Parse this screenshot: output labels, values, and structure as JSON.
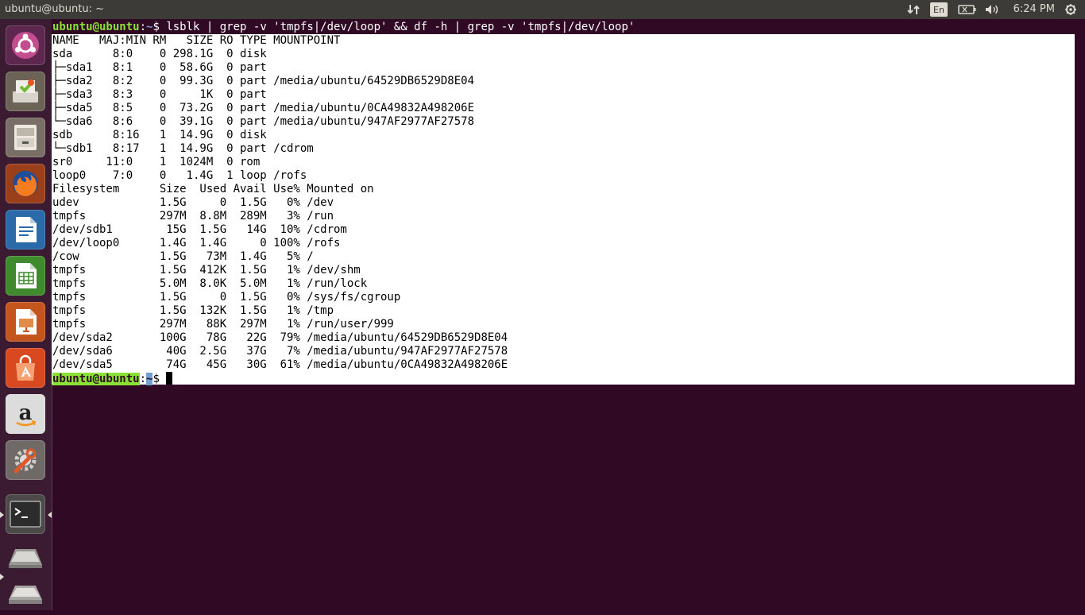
{
  "top_panel": {
    "window_title": "ubuntu@ubuntu: ~",
    "language": "En",
    "clock": "6:24 PM"
  },
  "launcher": {
    "items": [
      {
        "name": "dash-home",
        "icon": "ubuntu-logo-icon"
      },
      {
        "name": "install-ubuntu",
        "icon": "installer-icon"
      },
      {
        "name": "files",
        "icon": "file-cabinet-icon"
      },
      {
        "name": "firefox",
        "icon": "firefox-icon"
      },
      {
        "name": "libreoffice-writer",
        "icon": "writer-icon"
      },
      {
        "name": "libreoffice-calc",
        "icon": "calc-icon"
      },
      {
        "name": "libreoffice-impress",
        "icon": "impress-icon"
      },
      {
        "name": "ubuntu-software",
        "icon": "shopping-bag-icon"
      },
      {
        "name": "amazon",
        "icon": "amazon-icon"
      },
      {
        "name": "system-settings",
        "icon": "wrench-gear-icon"
      },
      {
        "name": "terminal",
        "icon": "terminal-icon"
      },
      {
        "name": "workspace-switcher",
        "icon": "workspace-icon"
      },
      {
        "name": "trash",
        "icon": "trash-icon"
      }
    ]
  },
  "terminal": {
    "prompt_user": "ubuntu@ubuntu",
    "prompt_sep": ":",
    "prompt_path": "~",
    "prompt_end": "$ ",
    "command": "lsblk | grep -v 'tmpfs|/dev/loop' && df -h | grep -v 'tmpfs|/dev/loop'",
    "lines": [
      "NAME   MAJ:MIN RM   SIZE RO TYPE MOUNTPOINT",
      "sda      8:0    0 298.1G  0 disk",
      "├─sda1   8:1    0  58.6G  0 part",
      "├─sda2   8:2    0  99.3G  0 part /media/ubuntu/64529DB6529D8E04",
      "├─sda3   8:3    0     1K  0 part",
      "├─sda5   8:5    0  73.2G  0 part /media/ubuntu/0CA49832A498206E",
      "└─sda6   8:6    0  39.1G  0 part /media/ubuntu/947AF2977AF27578",
      "sdb      8:16   1  14.9G  0 disk",
      "└─sdb1   8:17   1  14.9G  0 part /cdrom",
      "sr0     11:0    1  1024M  0 rom",
      "loop0    7:0    0   1.4G  1 loop /rofs",
      "Filesystem      Size  Used Avail Use% Mounted on",
      "udev            1.5G     0  1.5G   0% /dev",
      "tmpfs           297M  8.8M  289M   3% /run",
      "/dev/sdb1        15G  1.5G   14G  10% /cdrom",
      "/dev/loop0      1.4G  1.4G     0 100% /rofs",
      "/cow            1.5G   73M  1.4G   5% /",
      "tmpfs           1.5G  412K  1.5G   1% /dev/shm",
      "tmpfs           5.0M  8.0K  5.0M   1% /run/lock",
      "tmpfs           1.5G     0  1.5G   0% /sys/fs/cgroup",
      "tmpfs           1.5G  132K  1.5G   1% /tmp",
      "tmpfs           297M   88K  297M   1% /run/user/999",
      "/dev/sda2       100G   78G   22G  79% /media/ubuntu/64529DB6529D8E04",
      "/dev/sda6        40G  2.5G   37G   7% /media/ubuntu/947AF2977AF27578",
      "/dev/sda5        74G   45G   30G  61% /media/ubuntu/0CA49832A498206E"
    ]
  }
}
